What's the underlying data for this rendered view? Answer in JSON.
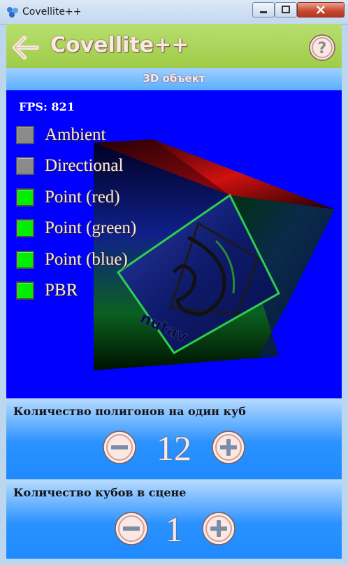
{
  "window": {
    "title": "Covellite++"
  },
  "header": {
    "title": "Covellite++"
  },
  "subtitle": "3D объект",
  "scene": {
    "fps_label": "FPS: 821",
    "lights": [
      {
        "label": "Ambient",
        "checked": false
      },
      {
        "label": "Directional",
        "checked": false
      },
      {
        "label": "Point (red)",
        "checked": true
      },
      {
        "label": "Point (green)",
        "checked": true
      },
      {
        "label": "Point (blue)",
        "checked": true
      },
      {
        "label": "PBR",
        "checked": true
      }
    ],
    "cube_text": "nutav"
  },
  "polygons": {
    "label": "Количество полигонов на один куб",
    "value": "12"
  },
  "cubes": {
    "label": "Количество кубов в сцене",
    "value": "1"
  },
  "colors": {
    "header": "#a8d456",
    "accent": "#1e90ff",
    "scene_bg": "#0000ff",
    "checked": "#00ee00",
    "unchecked": "#8a8a8a",
    "text_light": "#fde7e3"
  },
  "icons": {
    "back": "arrow-left-icon",
    "help": "question-circle-icon",
    "minus": "minus-circle-icon",
    "plus": "plus-circle-icon"
  }
}
